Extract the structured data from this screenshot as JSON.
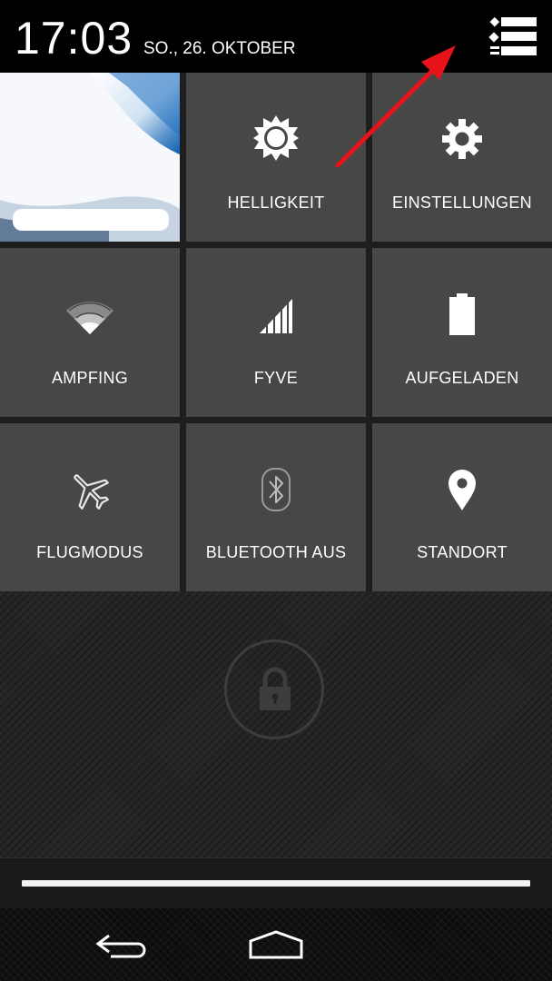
{
  "status": {
    "time": "17:03",
    "date": "SO., 26. OKTOBER"
  },
  "header": {
    "notifications_icon": "notification-list-icon"
  },
  "tiles": {
    "user": {
      "icon": "user-photo"
    },
    "brightness": {
      "label": "HELLIGKEIT",
      "icon": "sun-icon"
    },
    "settings": {
      "label": "EINSTELLUNGEN",
      "icon": "gear-icon"
    },
    "wifi": {
      "label": "AMPFING",
      "icon": "wifi-icon"
    },
    "mobile": {
      "label": "FYVE",
      "icon": "signal-icon"
    },
    "battery": {
      "label": "AUFGELADEN",
      "icon": "battery-icon"
    },
    "airplane": {
      "label": "FLUGMODUS",
      "icon": "airplane-icon"
    },
    "bluetooth": {
      "label": "BLUETOOTH AUS",
      "icon": "bluetooth-icon"
    },
    "location": {
      "label": "STANDORT",
      "icon": "location-pin-icon"
    }
  },
  "lockscreen": {
    "icon": "lock-icon"
  },
  "navigation": {
    "back_icon": "back-icon",
    "home_icon": "home-icon"
  },
  "annotation": {
    "icon": "red-arrow",
    "color": "#e8131a"
  },
  "colors": {
    "tile": "#474747",
    "header": "#000000",
    "accent": "#ffffff"
  }
}
